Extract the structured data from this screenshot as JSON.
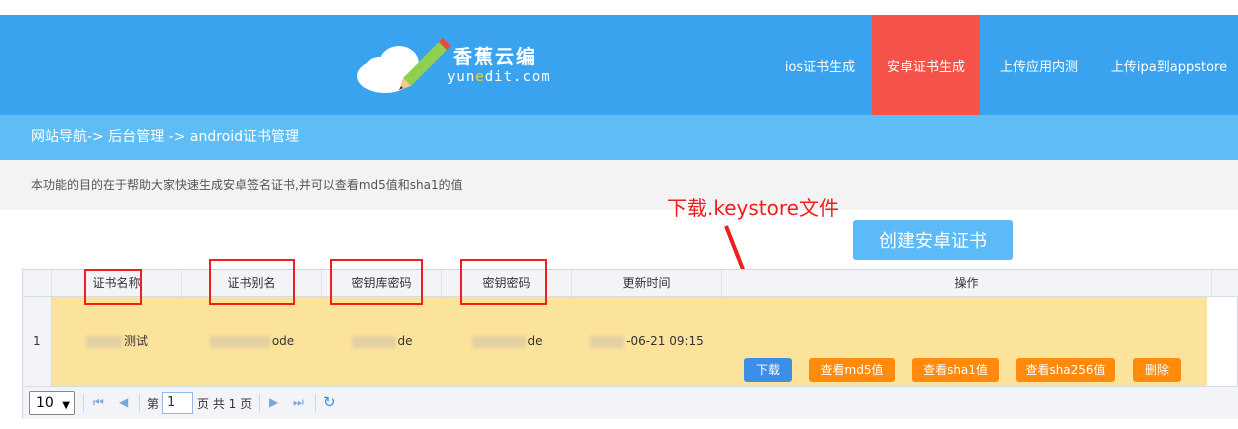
{
  "header": {
    "logo_cn": "香蕉云编",
    "logo_en_prefix": "yun",
    "logo_en_highlight": "e",
    "logo_en_suffix": "dit.com",
    "nav": [
      {
        "label": "ios证书生成",
        "active": false
      },
      {
        "label": "安卓证书生成",
        "active": true
      },
      {
        "label": "上传应用内测",
        "active": false
      },
      {
        "label": "上传ipa到appstore",
        "active": false
      }
    ]
  },
  "breadcrumb": "网站导航-> 后台管理 -> android证书管理",
  "description": "本功能的目的在于帮助大家快速生成安卓签名证书,并可以查看md5值和sha1的值",
  "annotation": "下载.keystore文件",
  "create_button": "创建安卓证书",
  "table": {
    "columns": [
      "证书名称",
      "证书别名",
      "密钥库密码",
      "密钥密码",
      "更新时间",
      "操作"
    ],
    "rows": [
      {
        "index": "1",
        "name_suffix": "测试",
        "alias_suffix": "ode",
        "store_pwd_suffix": "de",
        "key_pwd_suffix": "de",
        "updated_suffix": "-06-21 09:15"
      }
    ],
    "actions": {
      "download": "下载",
      "md5": "查看md5值",
      "sha1": "查看sha1值",
      "sha256": "查看sha256值",
      "delete": "删除"
    }
  },
  "pager": {
    "page_size": "10",
    "page_label_before": "第",
    "page_value": "1",
    "page_label_after": "页 共 1 页"
  },
  "colors": {
    "header_bg": "#3aa3f0",
    "nav_active": "#f5534a",
    "breadcrumb_bg": "#5ebdf5",
    "row_highlight": "#fce39b",
    "annotation": "#f01e1e",
    "btn_blue": "#3c8ee6",
    "btn_orange": "#ff8a0c"
  }
}
